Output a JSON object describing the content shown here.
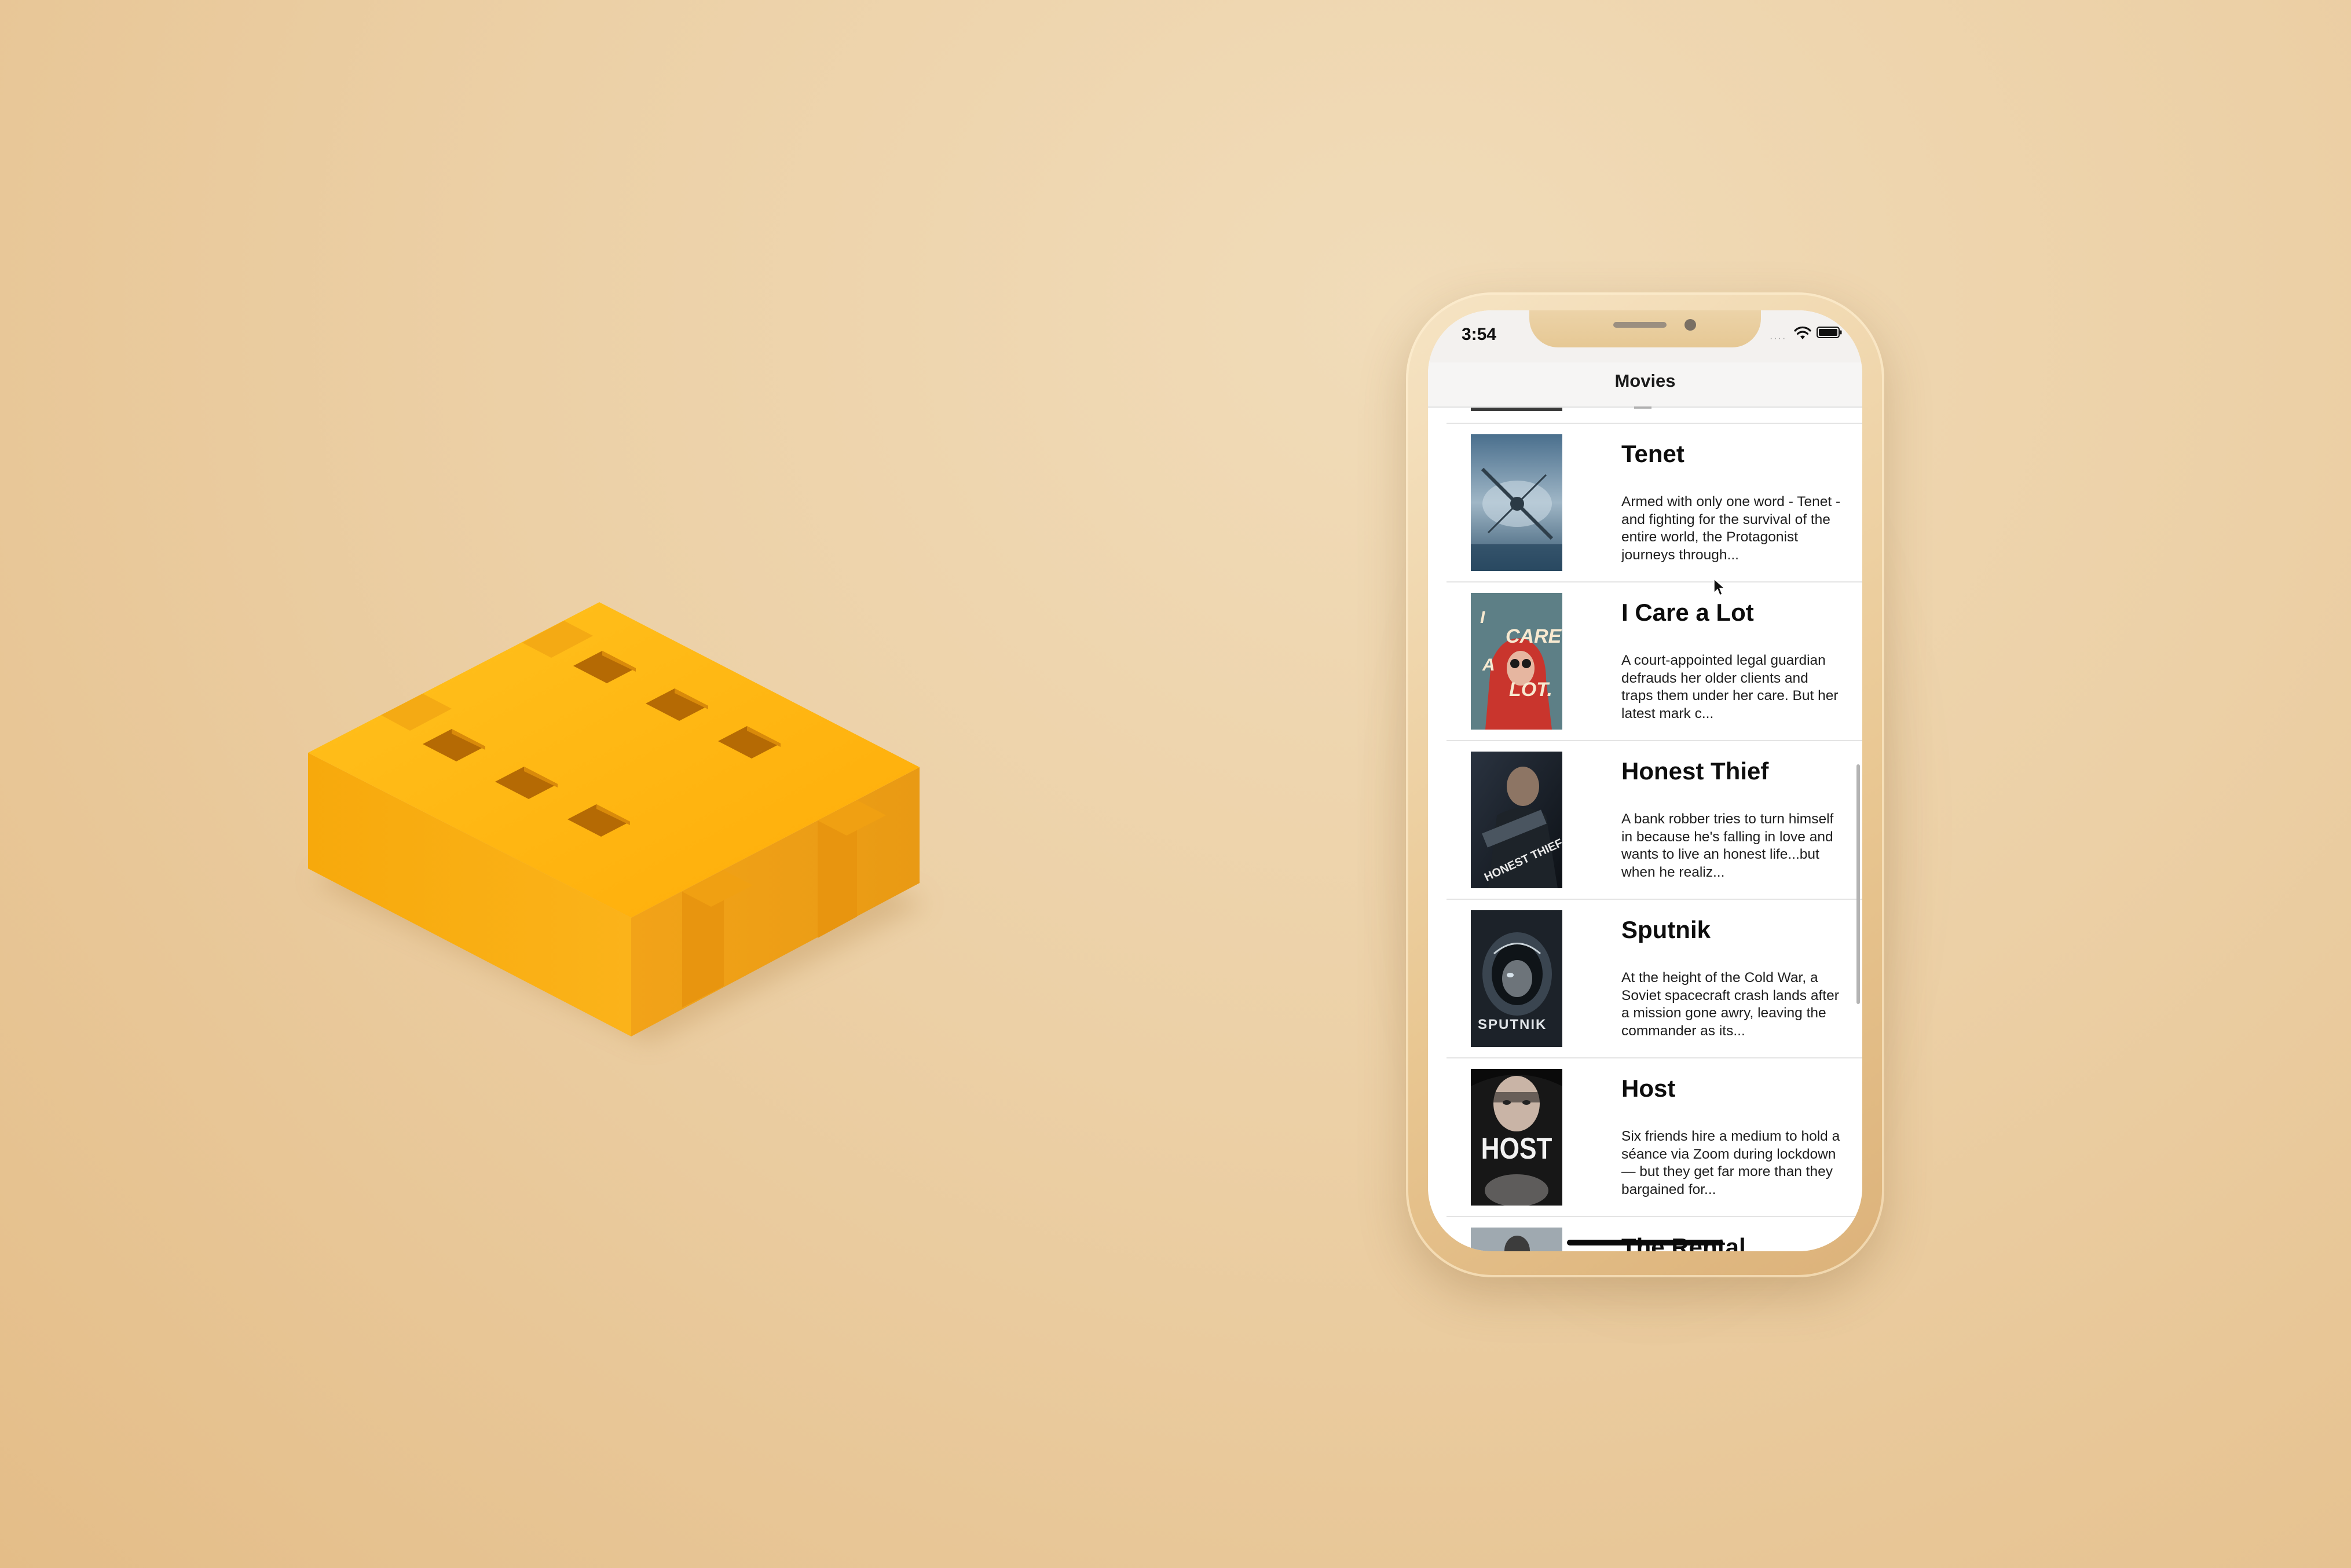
{
  "background_color": "#ecd0a6",
  "logo": {
    "icon": "film-strip-3d-icon",
    "color": "#ffb20f"
  },
  "status_bar": {
    "time": "3:54",
    "signal_icon": "cellular-signal-icon",
    "wifi_icon": "wifi-icon",
    "battery_icon": "battery-icon"
  },
  "nav": {
    "title": "Movies"
  },
  "movies": [
    {
      "title": "Tenet",
      "overview": "Armed with only one word - Tenet - and fighting for the survival of the entire world, the Protagonist journeys through...",
      "poster": "tenet-poster"
    },
    {
      "title": "I Care a Lot",
      "overview": "A court-appointed legal guardian defrauds her older clients and traps them under her care. But her latest mark c...",
      "poster": "i-care-a-lot-poster"
    },
    {
      "title": "Honest Thief",
      "overview": "A bank robber tries to turn himself in because he's falling in love and wants to live an honest life...but when he realiz...",
      "poster": "honest-thief-poster"
    },
    {
      "title": "Sputnik",
      "overview": "At the height of the Cold War, a Soviet spacecraft crash lands after a mission gone awry, leaving the commander as its...",
      "poster": "sputnik-poster"
    },
    {
      "title": "Host",
      "overview": "Six friends hire a medium to hold a séance via Zoom during lockdown — but they get far more than they bargained for...",
      "poster": "host-poster"
    },
    {
      "title": "The Rental",
      "overview": "",
      "poster": "the-rental-poster"
    }
  ],
  "poster_text": {
    "i_care_a_lot": [
      "I",
      "CARE",
      "A",
      "LOT."
    ],
    "honest_thief": "HONEST THIEF",
    "sputnik": "SPUTNIK",
    "host": "HOST"
  }
}
